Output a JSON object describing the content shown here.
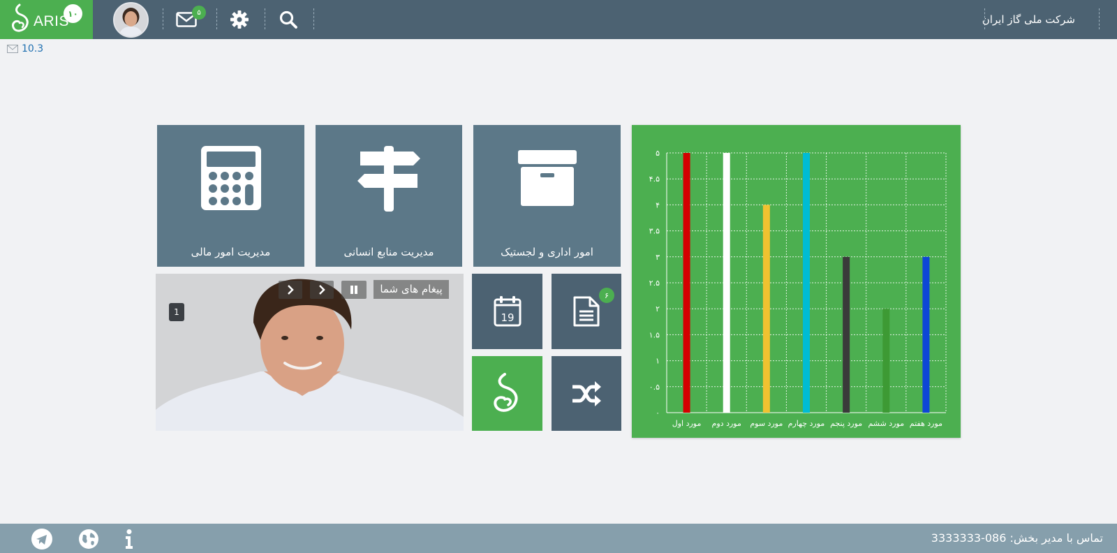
{
  "header": {
    "logo_text": "ARIS",
    "logo_badge": "۱۰",
    "mail_badge": "۵",
    "company_name": "شرکت ملی گاز ایران"
  },
  "version": "10.3",
  "tiles": {
    "finance": "مدیریت امور مالی",
    "hr": "مدیریت منابع انسانی",
    "admin": "امور اداری و لجستیک"
  },
  "small_tiles": {
    "calendar_day": "19",
    "document_badge": "۶"
  },
  "slider": {
    "title": "پیغام های شما",
    "slide_number": "1"
  },
  "chart_data": {
    "type": "bar",
    "categories": [
      "مورد اول",
      "مورد دوم",
      "مورد سوم",
      "مورد چهارم",
      "مورد پنجم",
      "مورد ششم",
      "مورد هفتم"
    ],
    "values": [
      5,
      5,
      4,
      5,
      3,
      2,
      3
    ],
    "colors": [
      "#d40000",
      "#ffffff",
      "#f0c230",
      "#00bcd4",
      "#3a3a3a",
      "#3d9a34",
      "#0d47d6"
    ],
    "ylim": [
      0,
      5
    ],
    "yticks": [
      "۰",
      "۰.۵",
      "۱",
      "۱.۵",
      "۲",
      "۲.۵",
      "۳",
      "۳.۵",
      "۴",
      "۴.۵",
      "۵"
    ],
    "grid": true
  },
  "footer": {
    "contact": "تماس با مدیر بخش: 086-3333333"
  },
  "colors": {
    "accent": "#4caf50",
    "topbar": "#4c6272",
    "tile": "#5c7888",
    "footer": "#869fac"
  }
}
